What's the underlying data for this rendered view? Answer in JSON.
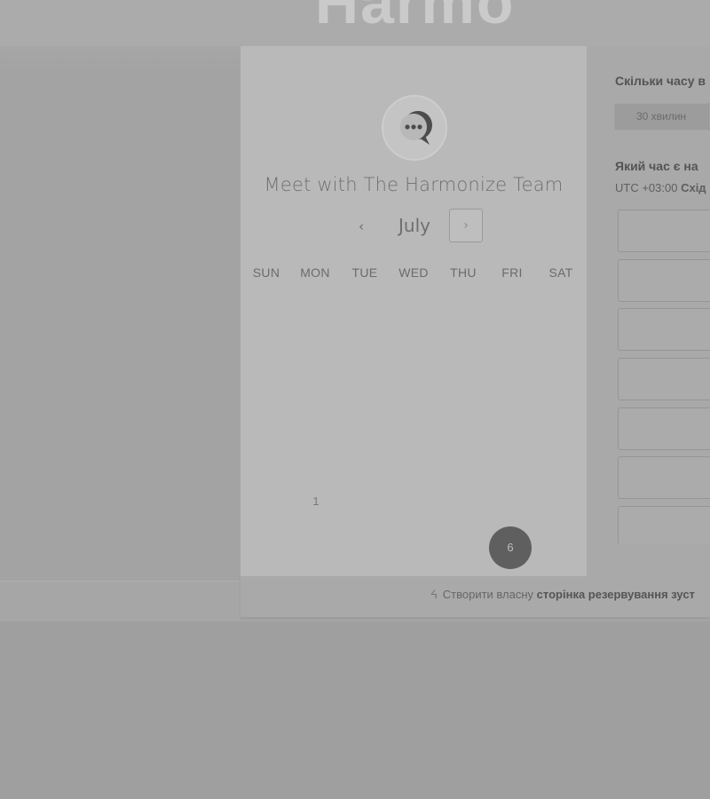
{
  "header": {
    "logo_text": "Harmo"
  },
  "scheduler": {
    "title": "Meet with The Harmonize Team",
    "avatar_icon": "chat-bubble-icon",
    "month": "July",
    "prev_symbol": "‹",
    "next_symbol": "›",
    "weekdays": [
      "SUN",
      "MON",
      "TUE",
      "WED",
      "THU",
      "FRI",
      "SAT"
    ],
    "days": [
      {
        "label": "1",
        "weekday": "MON",
        "week": 1,
        "state": "disabled"
      },
      {
        "label": "6",
        "weekday": "SAT",
        "week": 1,
        "state": "available"
      }
    ]
  },
  "booking": {
    "duration_question": "Скільки часу в",
    "duration_options": [
      "30 хвилин"
    ],
    "time_question": "Який час є на",
    "timezone_prefix": "UTC +03:00",
    "timezone_name": "Схід",
    "time_slot_count": 7
  },
  "footer": {
    "icon": "hubspot-sprocket-icon",
    "text_plain": "Створити власну",
    "text_bold": "сторінка резервування зуст"
  },
  "colors": {
    "selected_day": "#5f5f5f",
    "page_bg": "#9f9f9f",
    "calendar_bg": "#b9b9b9"
  }
}
